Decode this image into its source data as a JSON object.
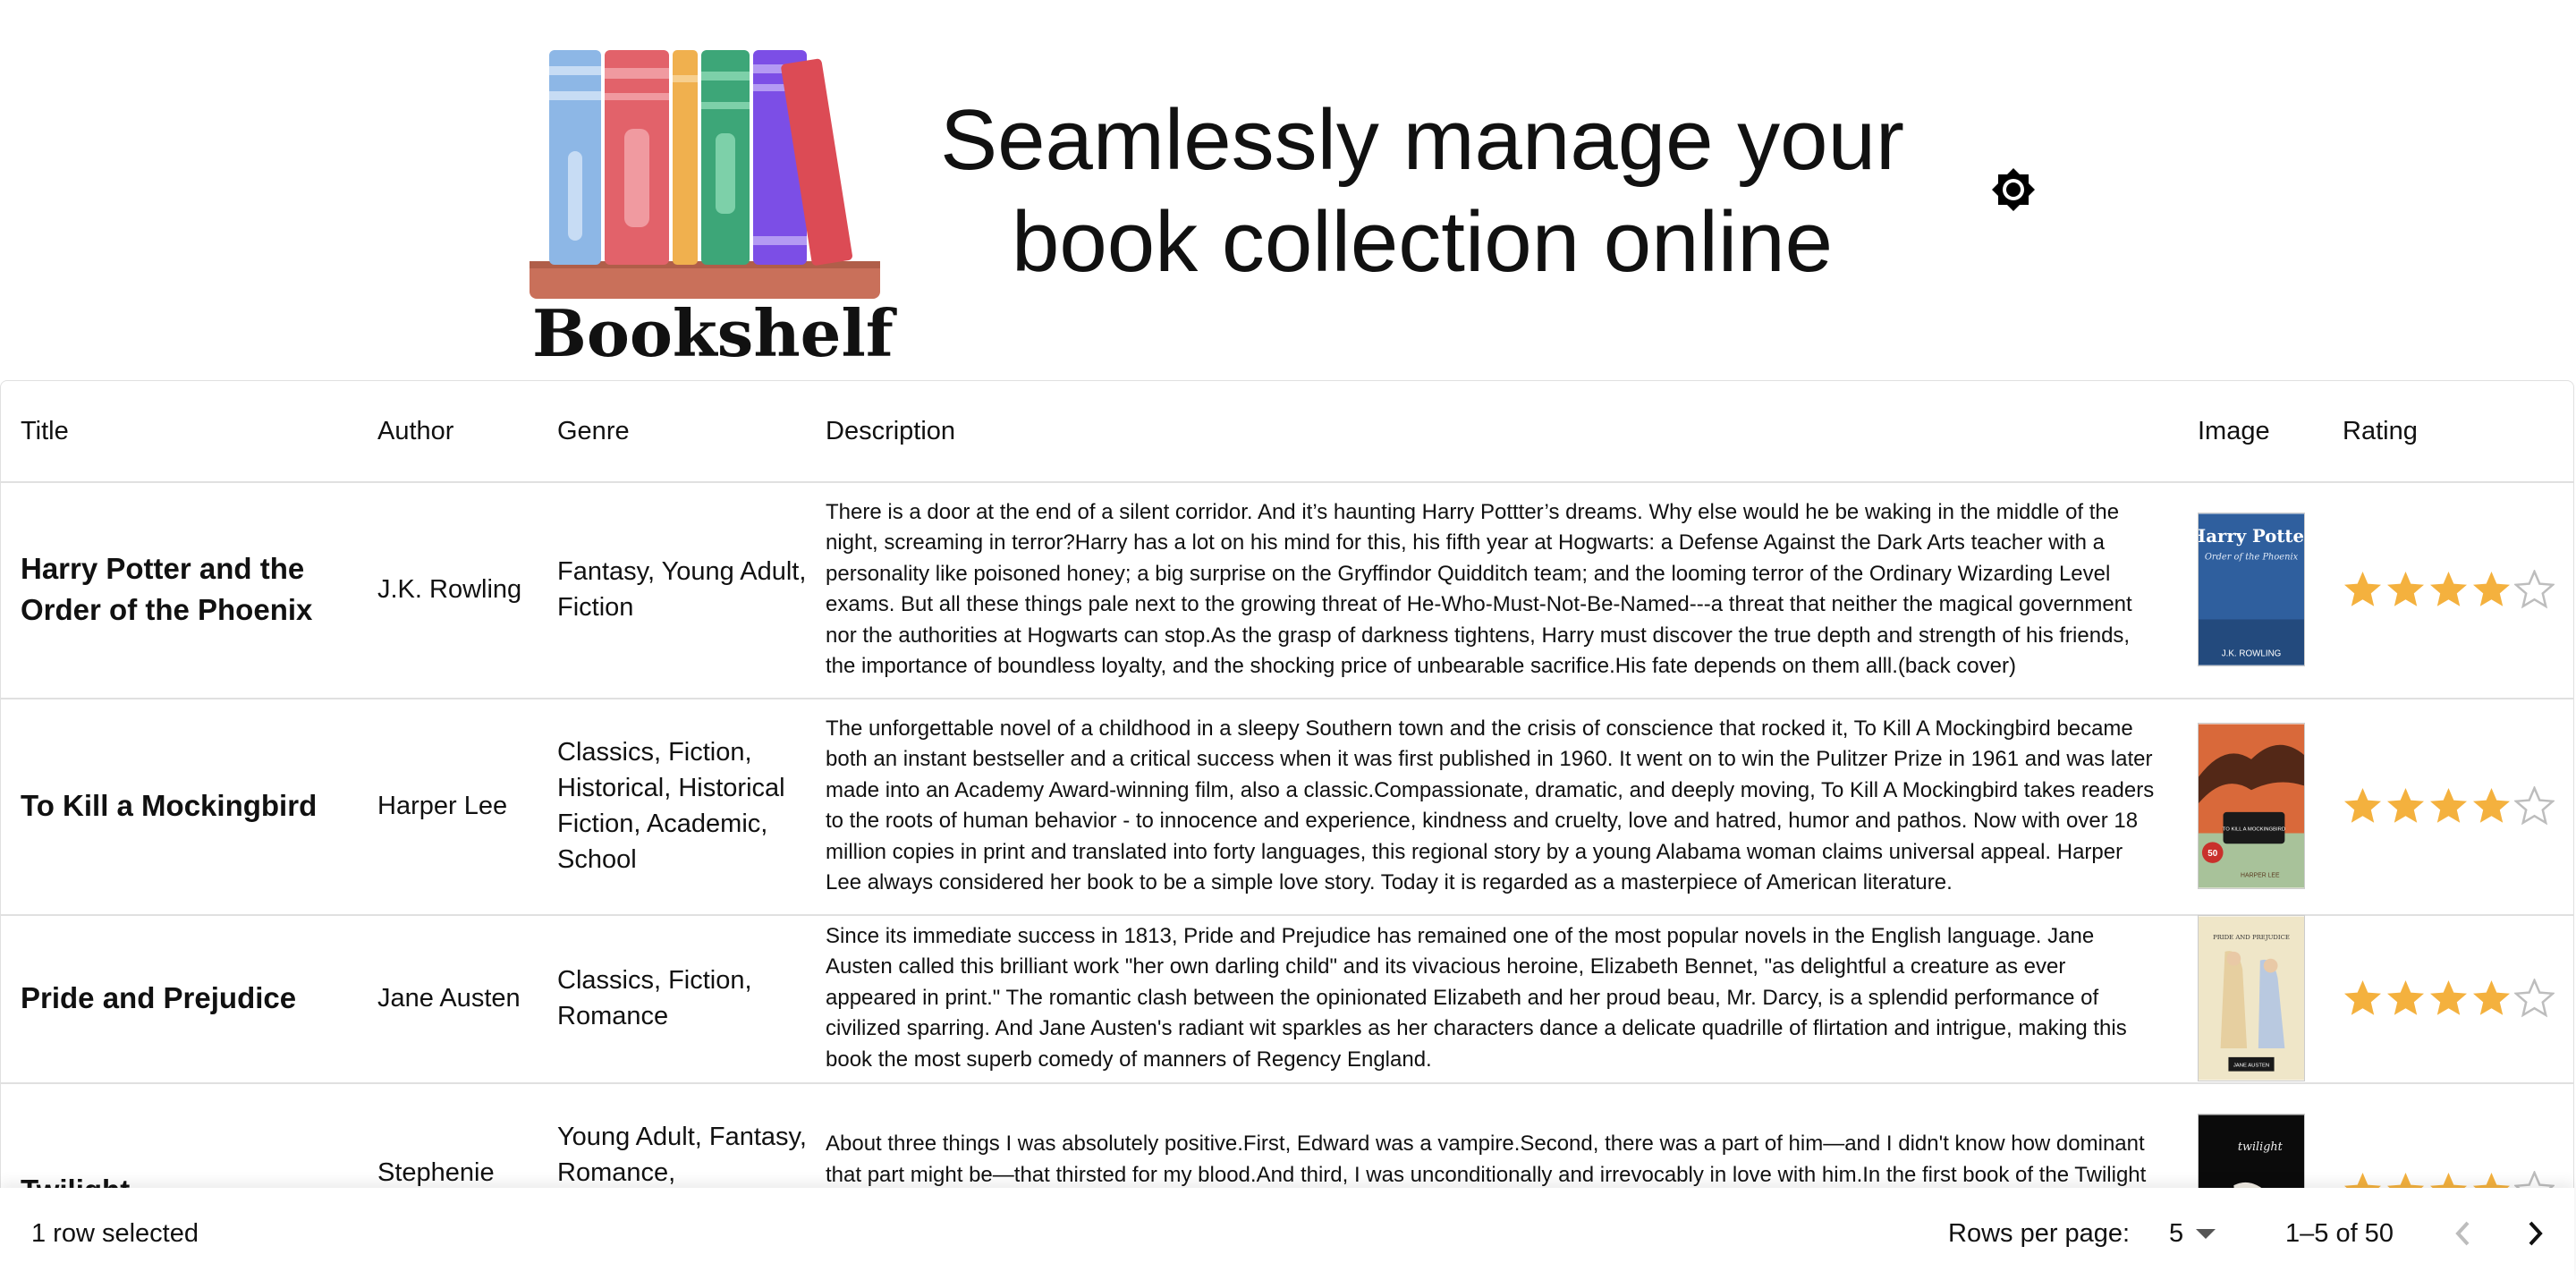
{
  "header": {
    "logo_text": "Bookshelf",
    "tagline_line1": "Seamlessly manage your",
    "tagline_line2": "book collection online"
  },
  "table": {
    "columns": [
      "Title",
      "Author",
      "Genre",
      "Description",
      "Image",
      "Rating"
    ],
    "rows": [
      {
        "title": "Harry Potter and the Order of the Phoenix",
        "author": "J.K. Rowling",
        "genre": "Fantasy, Young Adult, Fiction",
        "description": "There is a door at the end of a silent corridor. And it’s haunting Harry Pottter’s dreams. Why else would he be waking in the middle of the night, screaming in terror?Harry has a lot on his mind for this, his fifth year at Hogwarts: a Defense Against the Dark Arts teacher with a personality like poisoned honey; a big surprise on the Gryffindor Quidditch team; and the looming terror of the Ordinary Wizarding Level exams. But all these things pale next to the growing threat of He-Who-Must-Not-Be-Named---a threat that neither the magical government nor the authorities at Hogwarts can stop.As the grasp of darkness tightens, Harry must discover the true depth and strength of his friends, the importance of boundless loyalty, and the shocking price of unbearable sacrifice.His fate depends on them alll.(back cover)",
        "rating": 4,
        "cover_title": "Harry Potter",
        "cover_subtitle": "Order of the Phoenix",
        "cover_author": "J.K. ROWLING"
      },
      {
        "title": "To Kill a Mockingbird",
        "author": "Harper Lee",
        "genre": "Classics, Fiction, Historical, Historical Fiction, Academic, School",
        "description": "The unforgettable novel of a childhood in a sleepy Southern town and the crisis of conscience that rocked it, To Kill A Mockingbird became both an instant bestseller and a critical success when it was first published in 1960. It went on to win the Pulitzer Prize in 1961 and was later made into an Academy Award-winning film, also a classic.Compassionate, dramatic, and deeply moving, To Kill A Mockingbird takes readers to the roots of human behavior - to innocence and experience, kindness and cruelty, love and hatred, humor and pathos. Now with over 18 million copies in print and translated into forty languages, this regional story by a young Alabama woman claims universal appeal. Harper Lee always considered her book to be a simple love story. Today it is regarded as a masterpiece of American literature.",
        "rating": 4,
        "cover_title": "TO KILL A MOCKINGBIRD",
        "cover_badge": "50",
        "cover_author": "HARPER LEE"
      },
      {
        "title": "Pride and Prejudice",
        "author": "Jane Austen",
        "genre": "Classics, Fiction, Romance",
        "description": "Since its immediate success in 1813, Pride and Prejudice has remained one of the most popular novels in the English language. Jane Austen called this brilliant work \"her own darling child\" and its vivacious heroine, Elizabeth Bennet, \"as delightful a creature as ever appeared in print.\" The romantic clash between the opinionated Elizabeth and her proud beau, Mr. Darcy, is a splendid performance of civilized sparring. And Jane Austen's radiant wit sparkles as her characters dance a delicate quadrille of flirtation and intrigue, making this book the most superb comedy of manners of Regency England.",
        "rating": 4,
        "cover_title": "PRIDE AND PREJUDICE",
        "cover_author": "JANE AUSTEN"
      },
      {
        "title": "Twilight",
        "author": "Stephenie Meyer",
        "genre": "Young Adult, Fantasy, Romance, Paranormal, Vampires",
        "description": "About three things I was absolutely positive.First, Edward was a vampire.Second, there was a part of him—and I didn't know how dominant that part might be—that thirsted for my blood.And third, I was unconditionally and irrevocably in love with him.In the first book of the Twilight Saga, internationally bestselling author Stephenie Meyer introduces Bella Swan and Edward Cullen, a pair of star-crossed lovers whose forbidden relationship ripens against the backdrop of small-town suspicion and a mysterious coven of vampires.",
        "rating": 4,
        "cover_title": "twilight"
      }
    ]
  },
  "footer": {
    "selected_text": "1 row selected",
    "rows_per_page_label": "Rows per page:",
    "rows_per_page_value": "5",
    "range_text": "1–5 of 50"
  },
  "colors": {
    "star_filled": "#f4b13e",
    "star_empty": "#bdbdbd",
    "border": "#e0e0e0"
  }
}
